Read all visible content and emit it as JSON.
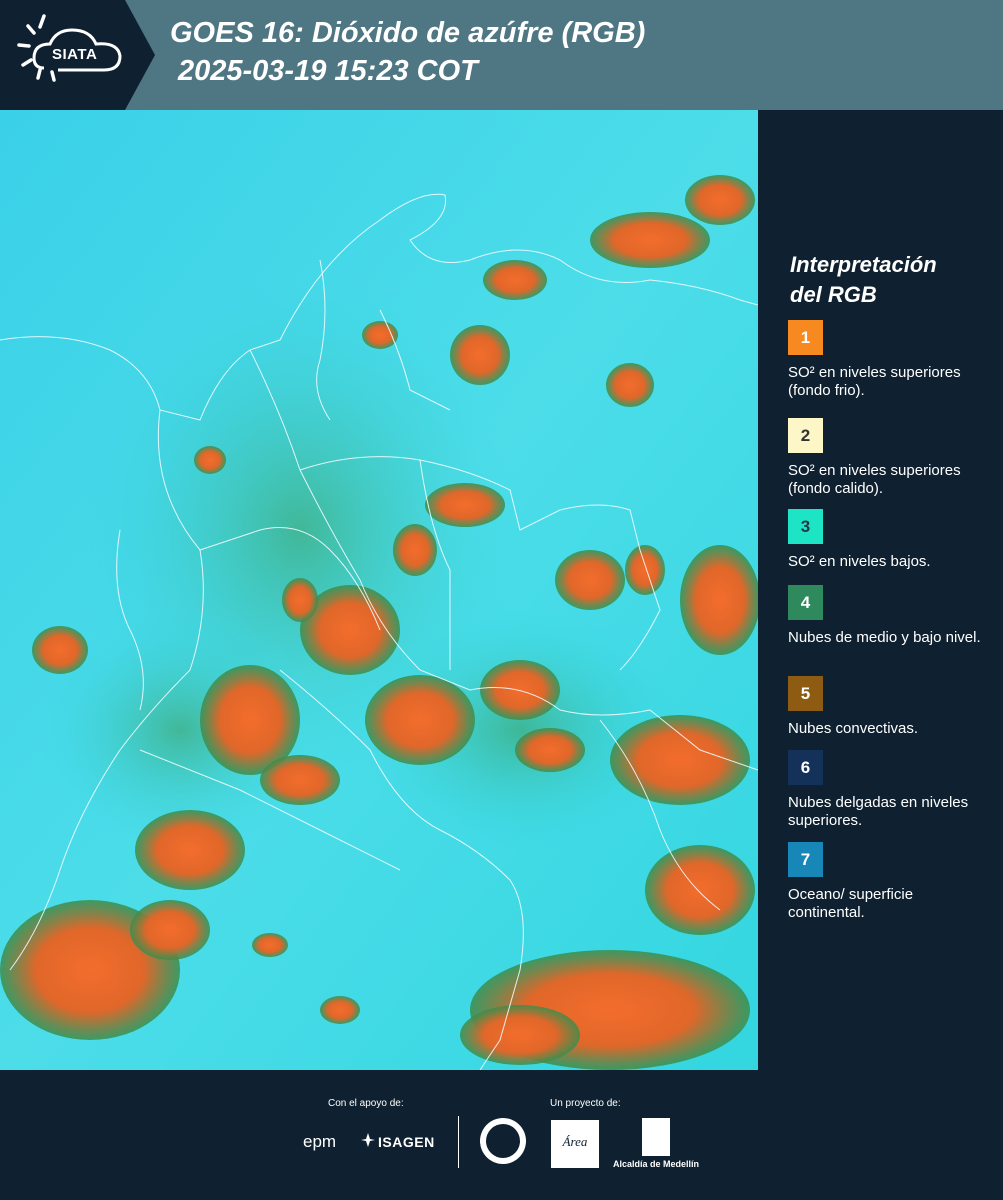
{
  "header": {
    "logo_text": "SIATA",
    "title_line1": "GOES 16: Dióxido de azúfre (RGB)",
    "title_line2": "2025-03-19 15:23 COT"
  },
  "legend": {
    "title_line1": "Interpretación",
    "title_line2": "del RGB",
    "items": [
      {
        "number": "1",
        "color": "#f6891f",
        "num_color": "#ffffff",
        "text": "SO² en niveles superiores (fondo frio)."
      },
      {
        "number": "2",
        "color": "#fdf6c6",
        "num_color": "#333333",
        "text": "SO² en niveles superiores (fondo calido)."
      },
      {
        "number": "3",
        "color": "#1de4c4",
        "num_color": "#1b3a4a",
        "text": "SO² en niveles bajos."
      },
      {
        "number": "4",
        "color": "#2e8a5c",
        "num_color": "#ffffff",
        "text": "Nubes de medio y bajo nivel."
      },
      {
        "number": "5",
        "color": "#8d5c12",
        "num_color": "#ffffff",
        "text": "Nubes convectivas."
      },
      {
        "number": "6",
        "color": "#14315a",
        "num_color": "#ffffff",
        "text": "Nubes delgadas en niveles superiores."
      },
      {
        "number": "7",
        "color": "#1687b6",
        "num_color": "#ffffff",
        "text": "Oceano/ superficie continental."
      }
    ]
  },
  "footer": {
    "support_label": "Con el apoyo de:",
    "project_label": "Un proyecto de:",
    "epm": "epm",
    "isagen": "ISAGEN",
    "area_logo": "Área",
    "alcaldia": "Alcaldía de Medellín"
  },
  "map": {
    "background_color": "#2fd5e3",
    "convective_color": "#ef6a2a",
    "vegetation_color": "#2e8b4a"
  }
}
